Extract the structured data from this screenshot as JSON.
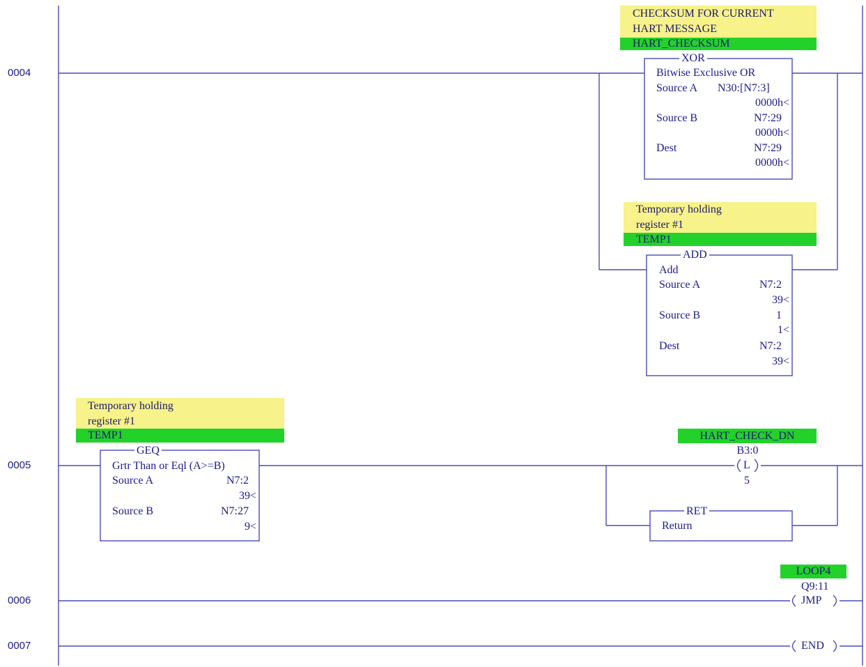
{
  "rungs": [
    {
      "number": "0004"
    },
    {
      "number": "0005"
    },
    {
      "number": "0006"
    },
    {
      "number": "0007"
    }
  ],
  "xor_block": {
    "comment_line1": "CHECKSUM FOR CURRENT",
    "comment_line2": "HART MESSAGE",
    "symbol": "HART_CHECKSUM",
    "title": "XOR",
    "description": "Bitwise Exclusive OR",
    "source_a_label": "Source A",
    "source_a_addr": "N30:[N7:3]",
    "source_a_val": "0000h<",
    "source_b_label": "Source B",
    "source_b_addr": "N7:29",
    "source_b_val": "0000h<",
    "dest_label": "Dest",
    "dest_addr": "N7:29",
    "dest_val": "0000h<"
  },
  "add_block": {
    "comment_line1": "Temporary holding",
    "comment_line2": "register #1",
    "symbol": "TEMP1",
    "title": "ADD",
    "description": "Add",
    "source_a_label": "Source A",
    "source_a_addr": "N7:2",
    "source_a_val": "39<",
    "source_b_label": "Source B",
    "source_b_addr": "1",
    "source_b_val": "1<",
    "dest_label": "Dest",
    "dest_addr": "N7:2",
    "dest_val": "39<"
  },
  "geq_block": {
    "comment_line1": "Temporary holding",
    "comment_line2": "register #1",
    "symbol": "TEMP1",
    "title": "GEQ",
    "description": "Grtr Than or Eql (A>=B)",
    "source_a_label": "Source A",
    "source_a_addr": "N7:2",
    "source_a_val": "39<",
    "source_b_label": "Source B",
    "source_b_addr": "N7:27",
    "source_b_val": "9<"
  },
  "latch_coil": {
    "symbol": "HART_CHECK_DN",
    "address": "B3:0",
    "type": "L",
    "bit": "5"
  },
  "ret_block": {
    "title": "RET",
    "description": "Return"
  },
  "jmp_coil": {
    "symbol": "LOOP4",
    "address": "Q9:11",
    "type": "JMP"
  },
  "end_coil": {
    "type": "END"
  },
  "colors": {
    "wire": "#4a4ab8",
    "text": "#1a1a8c",
    "comment_bg": "#f7f28a",
    "symbol_bg": "#22d22a"
  }
}
